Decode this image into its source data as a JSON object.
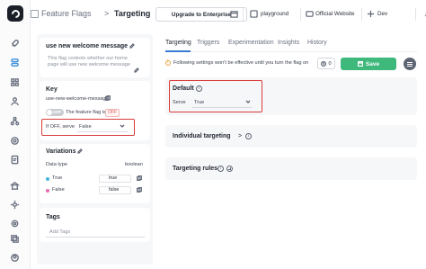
{
  "header": {
    "crumb_app": "Feature Flags",
    "crumb_sep": ">",
    "crumb_page": "Targeting",
    "upgrade_label": "Upgrade to Enterprise",
    "project": "playground",
    "environment_site": "Official Website",
    "environment": "Dev"
  },
  "flag": {
    "name": "use new welcome message",
    "description": "This flag controls whether our home page will use new welcome message"
  },
  "key_section": {
    "title": "Key",
    "value": "use-new-welcome-message",
    "toggle_text": "OFF",
    "status_prefix": "The feature flag is",
    "status_badge": "OFF",
    "serve_label": "If OFF, serve",
    "serve_value": "False"
  },
  "variations": {
    "title": "Variations",
    "data_type_label": "Data type",
    "data_type_value": "boolean",
    "items": [
      {
        "label": "True",
        "value": "true",
        "color": "#3fb8d8"
      },
      {
        "label": "False",
        "value": "false",
        "color": "#e76bb0"
      }
    ]
  },
  "tags": {
    "title": "Tags",
    "placeholder": "Add Tags"
  },
  "tabs": [
    "Targeting",
    "Triggers",
    "Experimentation",
    "Insights",
    "History"
  ],
  "notice": "Following settings won't be effective until you turn the flag on",
  "toolbar": {
    "schedule_count": "0",
    "save_label": "Save"
  },
  "default_section": {
    "title": "Default",
    "serve_label": "Serve",
    "serve_value": "True"
  },
  "individual_targeting": {
    "title": "Individual targeting",
    "chevron": ">"
  },
  "targeting_rules": {
    "title": "Targeting rules"
  },
  "colors": {
    "accent": "#3a7bd5",
    "save": "#3fb87c",
    "highlight": "#d93c3c",
    "off": "#e05a5a"
  }
}
